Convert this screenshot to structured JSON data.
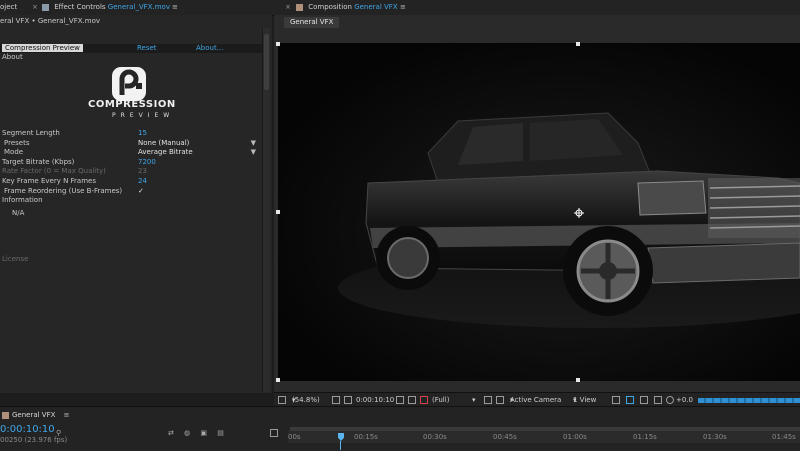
{
  "tabs": {
    "project": "oject",
    "effect_controls": "Effect Controls",
    "effect_file": "General_VFX.mov",
    "composition": "Composition",
    "comp_name": "General VFX",
    "menu_icon": "≡"
  },
  "left_panel": {
    "breadcrumb": "eral VFX • General_VFX.mov",
    "effect_name": "Compression Preview",
    "reset": "Reset",
    "about_link": "About...",
    "about_section": "About",
    "logo_line1": "COMPRESSION",
    "logo_line2": "PREVIEW",
    "segment_length_label": "Segment Length",
    "segment_length_value": "15",
    "presets_label": "Presets",
    "presets_value": "None (Manual)",
    "mode_label": "Mode",
    "mode_value": "Average Bitrate",
    "target_bitrate_label": "Target Bitrate (Kbps)",
    "target_bitrate_value": "7200",
    "rate_factor_label": "Rate Factor (0 = Max Quality)",
    "rate_factor_value": "23",
    "keyframe_label": "Key Frame Every N Frames",
    "keyframe_value": "24",
    "frame_reorder_label": "Frame Reordering (Use B-Frames)",
    "frame_reorder_check": "✓",
    "information_label": "Information",
    "information_value": "N/A",
    "license_label": "License"
  },
  "viewer": {
    "comp_tab": "General VFX"
  },
  "viewer_bar": {
    "zoom": "(54.8%)",
    "timecode": "0:00:10:10",
    "resolution": "(Full)",
    "camera": "Active Camera",
    "views": "1 View",
    "exposure": "+0.0"
  },
  "timeline": {
    "comp_tab": "General VFX",
    "current_time": "0:00:10:10",
    "fps": "00250 (23.976 fps)",
    "ruler": [
      "00s",
      "00:15s",
      "00:30s",
      "00:45s",
      "01:00s",
      "01:15s",
      "01:30s",
      "01:45s"
    ]
  },
  "colors": {
    "accent": "#3fa7e8",
    "panel": "#262626",
    "dark": "#1d1d1d"
  }
}
